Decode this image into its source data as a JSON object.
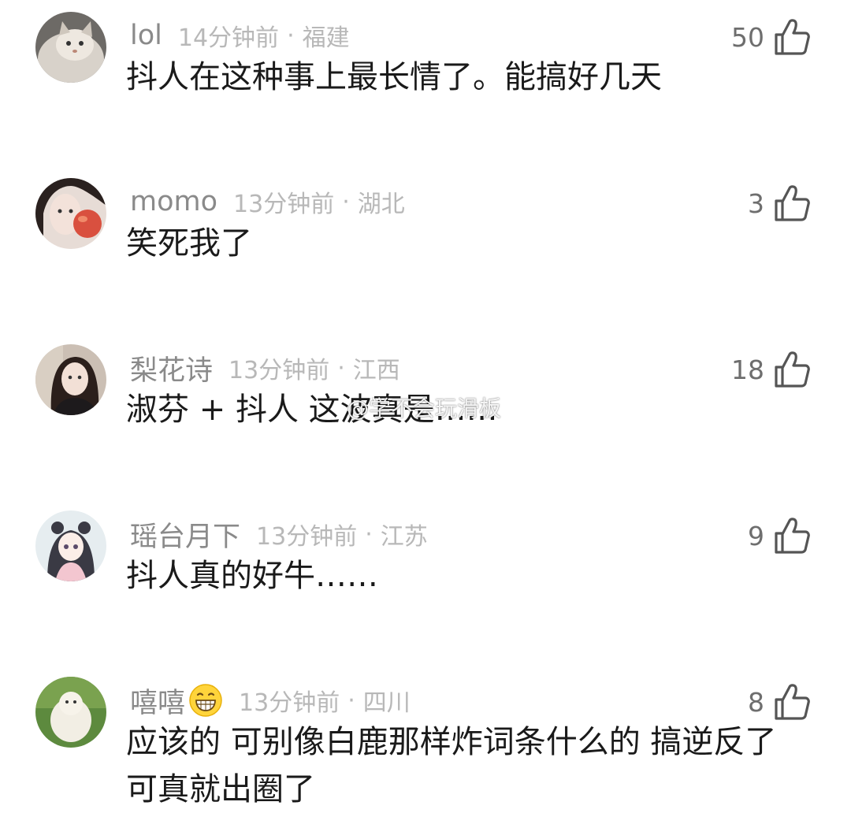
{
  "comments": [
    {
      "username": "lol",
      "time": "14分钟前",
      "separator": "·",
      "location": "福建",
      "text": "抖人在这种事上最长情了。能搞好几天",
      "likes": "50",
      "avatar": "cat-avatar"
    },
    {
      "username": "momo",
      "time": "13分钟前",
      "separator": "·",
      "location": "湖北",
      "text": "笑死我了",
      "likes": "3",
      "avatar": "girl-with-peach-avatar"
    },
    {
      "username": "梨花诗",
      "time": "13分钟前",
      "separator": "·",
      "location": "江西",
      "text": "淑芬 + 抖人 这波真是……",
      "likes": "18",
      "avatar": "girl-portrait-avatar"
    },
    {
      "username": "瑶台月下",
      "time": "13分钟前",
      "separator": "·",
      "location": "江苏",
      "text": "抖人真的好牛……",
      "likes": "9",
      "avatar": "anime-girl-avatar"
    },
    {
      "username": "嘻嘻",
      "time": "13分钟前",
      "separator": "·",
      "location": "四川",
      "text": "应该的 可别像白鹿那样炸词条什么的 搞逆反了可真就出圈了",
      "likes": "8",
      "avatar": "fluffy-animal-avatar",
      "name_emoji": "grinning-face-emoji"
    }
  ],
  "watermark": "@学不会玩滑板",
  "colors": {
    "username": "#8a8a8a",
    "meta": "#b8b8b8",
    "text": "#1a1a1a",
    "like": "#6e6e6e",
    "background": "#ffffff"
  }
}
